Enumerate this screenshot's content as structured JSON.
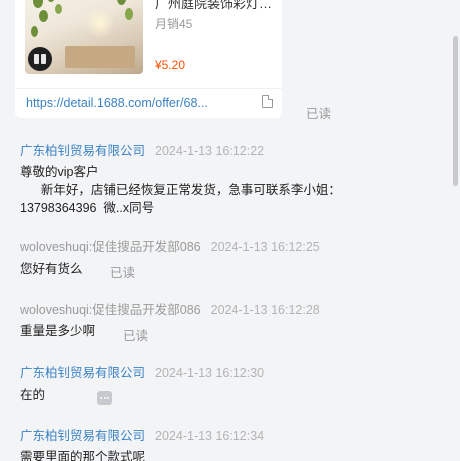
{
  "product_card": {
    "title": "广州庭院装饰彩灯…",
    "sales": "月销45",
    "price": "¥5.20",
    "link": "https://detail.1688.com/offer/68...",
    "read_status": "已读"
  },
  "messages": [
    {
      "sender": "广东柏钊贸易有限公司",
      "time": "2024-1-13 16:12:22",
      "lines": [
        "尊敬的vip客户",
        "      新年好，店铺已经恢复正常发货，急事可联系李小姐：",
        "13798364396  微..x同号"
      ]
    },
    {
      "sender": "woloveshuqi:促佳搜品开发部086",
      "time": "2024-1-13 16:12:25",
      "text": "您好有货么",
      "read_status": "已读"
    },
    {
      "sender": "woloveshuqi:促佳搜品开发部086",
      "time": "2024-1-13 16:12:28",
      "text": "重量是多少啊",
      "read_status": "已读"
    },
    {
      "sender": "广东柏钊贸易有限公司",
      "time": "2024-1-13 16:12:30",
      "text": "在的"
    },
    {
      "sender": "广东柏钊贸易有限公司",
      "time": "2024-1-13 16:12:34",
      "text": "需要里面的那个款式呢"
    }
  ],
  "colors": {
    "shop_name": "#3b82c4",
    "link": "#3b82c4",
    "price": "#ff5000",
    "background": "#f3f4f6"
  },
  "icons": [
    "product-badge-icon",
    "document-icon",
    "more-options-icon"
  ]
}
